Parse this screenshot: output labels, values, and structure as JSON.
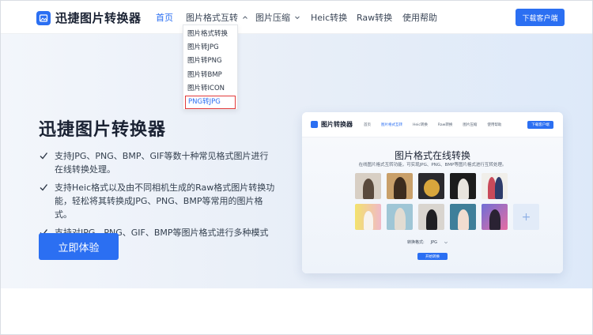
{
  "header": {
    "logo_text": "迅捷图片转换器",
    "nav": [
      {
        "label": "首页",
        "active": true
      },
      {
        "label": "图片格式互转",
        "has_dropdown": true
      },
      {
        "label": "图片压缩",
        "has_dropdown": true
      },
      {
        "label": "Heic转换"
      },
      {
        "label": "Raw转换"
      },
      {
        "label": "使用帮助"
      }
    ],
    "download_button": "下载客户端"
  },
  "dropdown": {
    "items": [
      "图片格式转换",
      "图片转JPG",
      "图片转PNG",
      "图片转BMP",
      "图片转ICON",
      "PNG转JPG"
    ],
    "highlighted": "PNG转JPG"
  },
  "hero": {
    "title": "迅捷图片转换器",
    "features": [
      "支持JPG、PNG、BMP、GIF等数十种常见格式图片进行在线转换处理。",
      "支持Heic格式以及由不同相机生成的Raw格式图片转换功能，轻松将其转换成JPG、PNG、BMP等常用的图片格式。",
      "支持对JPG、PNG、GIF、BMP等图片格式进行多种模式的压缩处理。"
    ],
    "cta_button": "立即体验"
  },
  "preview": {
    "logo_text": "图片转换器",
    "nav": [
      "首页",
      "图片格式互转",
      "Heic转换",
      "Raw转换",
      "图片压缩",
      "使用帮助"
    ],
    "download_button": "下载客户端",
    "title": "图片格式在线转换",
    "subtitle": "在线图片格式互转功能，可实现JPG、PNG、BMP等图片格式进行互转处理。",
    "format_label": "转换格式:",
    "format_value": "JPG",
    "convert_button": "开始转换",
    "add_icon": "+"
  },
  "colors": {
    "accent": "#2b6ff2",
    "highlight_border": "#e23a3a"
  }
}
